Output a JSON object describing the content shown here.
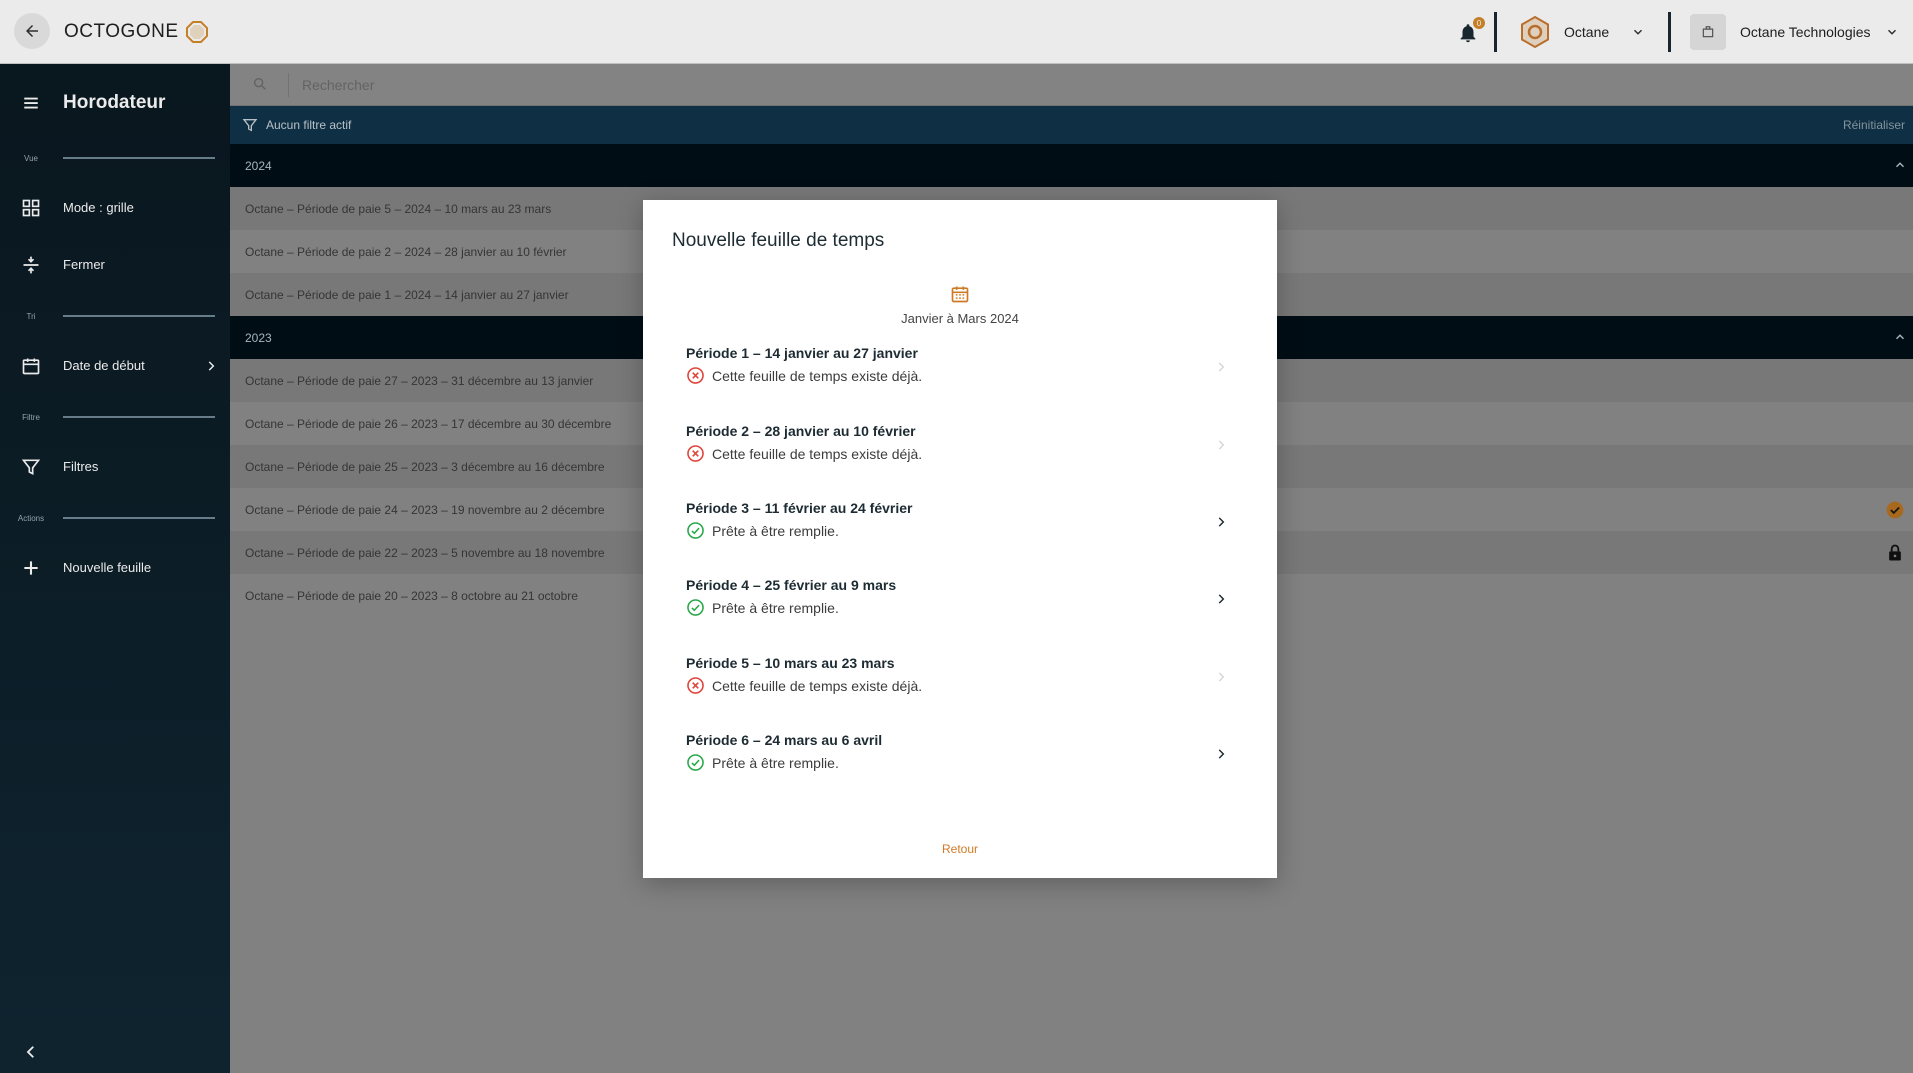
{
  "topbar": {
    "brand": "OCTOGONE",
    "notification_count": "0",
    "account_name": "Octane",
    "company_name": "Octane Technologies"
  },
  "sidebar": {
    "title": "Horodateur",
    "sections": {
      "view": "Vue",
      "sort": "Tri",
      "filter": "Filtre",
      "actions": "Actions"
    },
    "items": [
      {
        "label": "Mode : grille",
        "icon": "grid-icon"
      },
      {
        "label": "Fermer",
        "icon": "collapse-vertical-icon"
      },
      {
        "label": "Date de début",
        "icon": "calendar-icon"
      },
      {
        "label": "Filtres",
        "icon": "filter-icon"
      },
      {
        "label": "Nouvelle feuille",
        "icon": "plus-icon"
      }
    ]
  },
  "main": {
    "search_placeholder": "Rechercher",
    "filter_status": "Aucun filtre actif",
    "reset_label": "Réinitialiser",
    "groups": [
      {
        "year": "2024",
        "rows": [
          {
            "label": "Octane – Période de paie 5 – 2024 – 10 mars au 23 mars"
          },
          {
            "label": "Octane – Période de paie 2 – 2024 – 28 janvier au 10 février"
          },
          {
            "label": "Octane – Période de paie 1 – 2024 – 14 janvier au 27 janvier"
          }
        ]
      },
      {
        "year": "2023",
        "rows": [
          {
            "label": "Octane – Période de paie 27 – 2023 – 31 décembre au 13 janvier"
          },
          {
            "label": "Octane – Période de paie 26 – 2023 – 17 décembre au 30 décembre"
          },
          {
            "label": "Octane – Période de paie 25 – 2023 – 3 décembre au 16 décembre"
          },
          {
            "label": "Octane – Période de paie 24 – 2023 – 19 novembre au 2 décembre",
            "status_icon": "check-circle-icon"
          },
          {
            "label": "Octane – Période de paie 22 – 2023 – 5 novembre au 18 novembre",
            "status_icon": "lock-icon"
          },
          {
            "label": "Octane – Période de paie 20 – 2023 – 8 octobre au 21 octobre"
          }
        ]
      }
    ]
  },
  "modal": {
    "title": "Nouvelle feuille de temps",
    "range": "Janvier à Mars 2024",
    "periods": [
      {
        "title": "Période 1 – 14 janvier au 27 janvier",
        "status": "Cette feuille de temps existe déjà.",
        "available": false
      },
      {
        "title": "Période 2 – 28 janvier au 10 février",
        "status": "Cette feuille de temps existe déjà.",
        "available": false
      },
      {
        "title": "Période 3 – 11 février au 24 février",
        "status": "Prête à être remplie.",
        "available": true
      },
      {
        "title": "Période 4 – 25 février au 9 mars",
        "status": "Prête à être remplie.",
        "available": true
      },
      {
        "title": "Période 5 – 10 mars au 23 mars",
        "status": "Cette feuille de temps existe déjà.",
        "available": false
      },
      {
        "title": "Période 6 – 24 mars au 6 avril",
        "status": "Prête à être remplie.",
        "available": true
      }
    ],
    "back_label": "Retour"
  },
  "colors": {
    "accent": "#d07a25",
    "sidebar_bg": "#0a1921",
    "success": "#2aa84a",
    "error": "#e0443a"
  }
}
